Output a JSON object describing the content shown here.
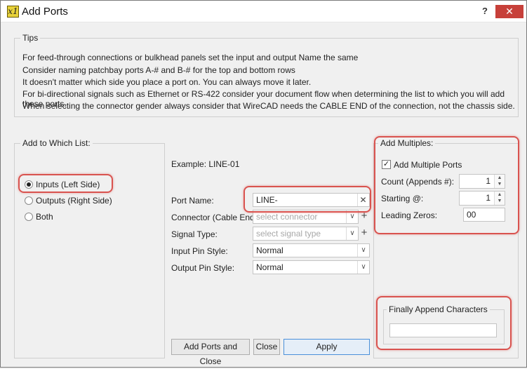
{
  "window": {
    "icon_text": "x1",
    "title": "Add Ports",
    "help_label": "?",
    "close_label": "✕"
  },
  "tips": {
    "legend": "Tips",
    "lines": [
      "For feed-through connections or bulkhead panels set the input and output Name the same",
      "Consider naming patchbay ports A-# and B-# for the top and bottom rows",
      "It doesn't matter which side you place a port on. You can always move it later.",
      "For bi-directional signals such as Ethernet or RS-422 consider your document flow when determining the list to which you will add these ports.",
      "When selecting the connector gender always consider that WireCAD needs the CABLE END of the connection, not the chassis side."
    ]
  },
  "add_to_list": {
    "legend": "Add to Which List:",
    "options": [
      {
        "label": "Inputs (Left Side)",
        "selected": true
      },
      {
        "label": "Outputs (Right Side)",
        "selected": false
      },
      {
        "label": "Both",
        "selected": false
      }
    ]
  },
  "port_form": {
    "example": "Example: LINE-01",
    "port_name_label": "Port Name:",
    "port_name_value": "LINE-",
    "clear_icon": "✕",
    "connector_label": "Connector (Cable End):",
    "connector_placeholder": "select connector",
    "signal_type_label": "Signal Type:",
    "signal_type_placeholder": "select signal type",
    "input_pin_style_label": "Input Pin Style:",
    "input_pin_style_value": "Normal",
    "output_pin_style_label": "Output Pin Style:",
    "output_pin_style_value": "Normal",
    "plus_label": "+",
    "dropdown_arrow": "∨"
  },
  "multiples": {
    "legend": "Add Multiples:",
    "checkbox_label": "Add Multiple Ports",
    "checkbox_checked": true,
    "check_mark": "✓",
    "count_label": "Count (Appends #):",
    "count_value": "1",
    "starting_label": "Starting @:",
    "starting_value": "1",
    "leading_zeros_label": "Leading Zeros:",
    "leading_zeros_value": "00",
    "spin_up": "▲",
    "spin_down": "▼"
  },
  "finally_append": {
    "legend": "Finally Append Characters",
    "value": ""
  },
  "buttons": {
    "add_and_close": "Add Ports and Close",
    "close": "Close",
    "apply": "Apply"
  },
  "colors": {
    "callout": "#d9534f",
    "close_button": "#c7403a",
    "primary_border": "#4a90d9"
  }
}
